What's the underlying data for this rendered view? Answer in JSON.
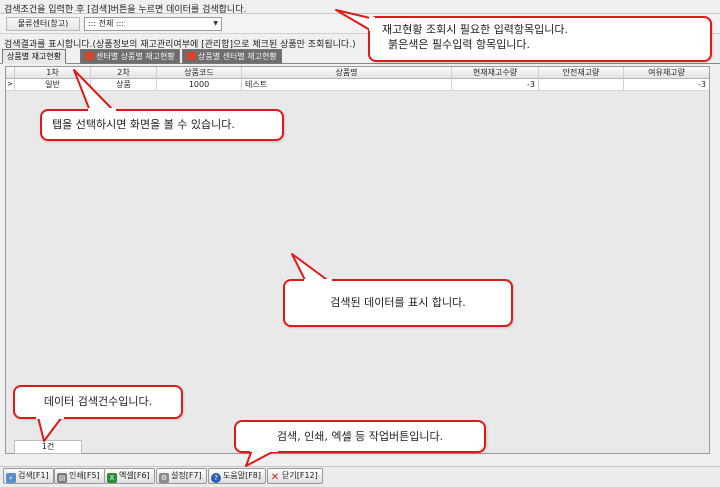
{
  "search": {
    "title": "검색조건을 입력한 후 [검색]버튼을 누르면 데이터를 검색합니다.",
    "center_label": "물류센터(창고)",
    "center_value": "::: 전체 :::"
  },
  "result": {
    "title": "검색결과를 표시합니다.(상품정보의 재고관리여부에 [관리함]으로 체크된 상품만 조회됩니다.)"
  },
  "tabs": [
    {
      "label": "상품별 재고현황"
    },
    {
      "label": "센터별 상품별 재고현황"
    },
    {
      "label": "상품별 센터별 재고현황"
    }
  ],
  "grid": {
    "columns": [
      "1차",
      "2차",
      "상품코드",
      "상품명",
      "현재재고수량",
      "안전재고량",
      "여유재고량"
    ],
    "row": {
      "indicator": ">",
      "cat1": "일반",
      "cat2": "상품",
      "code": "1000",
      "name": "테스트",
      "current": "-3",
      "safety": "",
      "spare": "-3"
    }
  },
  "count": "1건",
  "toolbar": {
    "search": "검색[F1]",
    "print": "인쇄[F5]",
    "excel": "엑셀[F6]",
    "settings": "설정[F7]",
    "help": "도움말[F8]",
    "close": "닫기[F12]"
  },
  "callouts": {
    "input_line1": "재고현황 조회시 필요한 입력항목입니다.",
    "input_line2": "붉은색은 필수입력 항목입니다.",
    "tabs": "탭을 선택하시면 화면을 볼 수 있습니다.",
    "data": "검색된 데이터를 표시 합니다.",
    "count": "데이터 검색건수입니다.",
    "buttons": "검색, 인쇄, 엑셀 등 작업버튼입니다."
  },
  "colors": {
    "callout_border": "#dd1a1a",
    "tab_inactive": "#6e6e6e"
  }
}
